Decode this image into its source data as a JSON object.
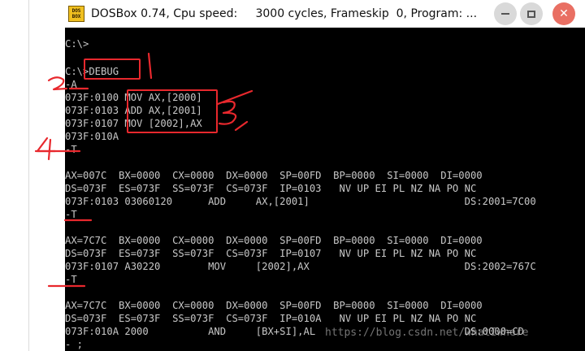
{
  "window": {
    "title": "DOSBox 0.74, Cpu speed:     3000 cycles, Frameskip  0, Program: ...",
    "icon_text": [
      "DOS",
      "BOX"
    ],
    "icons": {
      "minimize": "minimize-icon",
      "maximize": "maximize-icon",
      "close": "close-icon"
    },
    "close_glyph": "✕"
  },
  "console": {
    "lines": [
      "C:\\>",
      "",
      "C:\\>DEBUG",
      "-A",
      "073F:0100 MOV AX,[2000]",
      "073F:0103 ADD AX,[2001]",
      "073F:0107 MOV [2002],AX",
      "073F:010A",
      "-T",
      "",
      "AX=007C  BX=0000  CX=0000  DX=0000  SP=00FD  BP=0000  SI=0000  DI=0000",
      "DS=073F  ES=073F  SS=073F  CS=073F  IP=0103   NV UP EI PL NZ NA PO NC",
      "073F:0103 03060120      ADD     AX,[2001]                          DS:2001=7C00",
      "-T",
      "",
      "AX=7C7C  BX=0000  CX=0000  DX=0000  SP=00FD  BP=0000  SI=0000  DI=0000",
      "DS=073F  ES=073F  SS=073F  CS=073F  IP=0107   NV UP EI PL NZ NA PO NC",
      "073F:0107 A30220        MOV     [2002],AX                          DS:2002=767C",
      "-T",
      "",
      "AX=7C7C  BX=0000  CX=0000  DX=0000  SP=00FD  BP=0000  SI=0000  DI=0000",
      "DS=073F  ES=073F  SS=073F  CS=073F  IP=010A   NV UP EI PL NZ NA PO NC",
      "073F:010A 2000          AND     [BX+SI],AL                         DS:0000=CD",
      "- ;"
    ]
  },
  "annotations": {
    "color": "#e8282d",
    "labels": [
      "1",
      "2",
      "3",
      "4"
    ]
  },
  "watermark": "https://blog.csdn.net/whatIwhere"
}
